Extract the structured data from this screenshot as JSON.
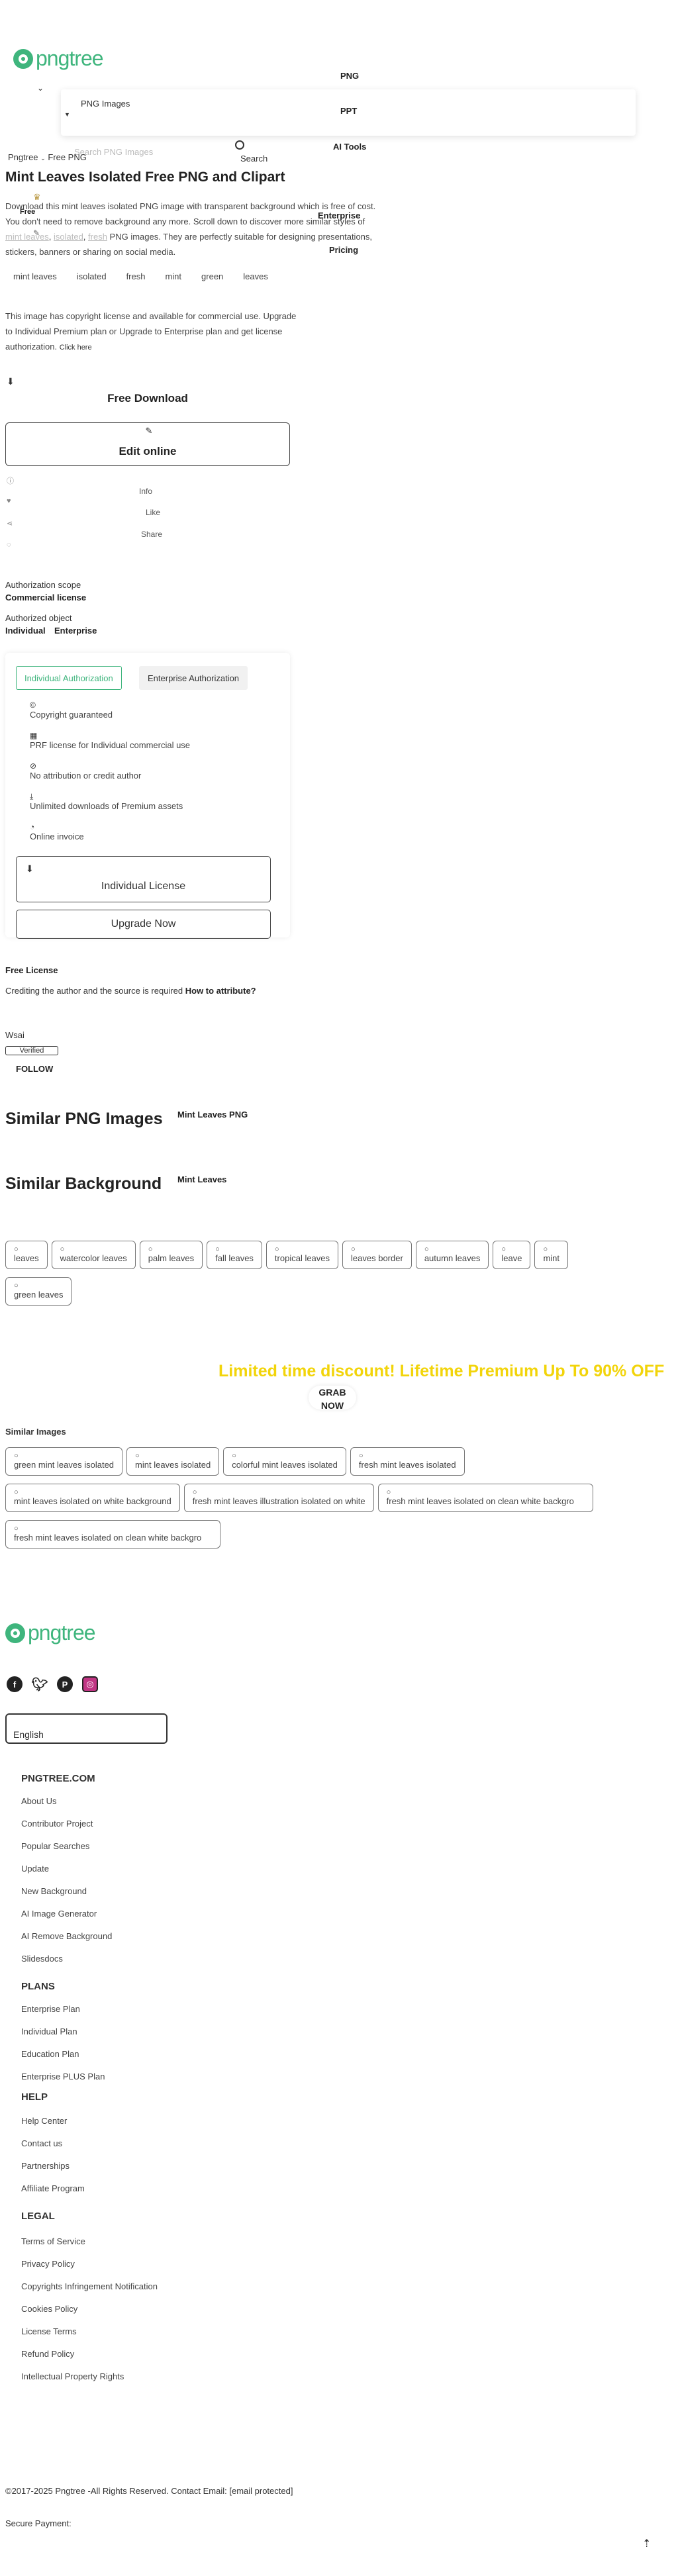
{
  "header": {
    "logo_text": "pngtree",
    "nav": {
      "png": "PNG",
      "ppt": "PPT",
      "ai_tools": "AI Tools",
      "enterprise": "Enterprise",
      "pricing": "Pricing",
      "free": "Free"
    },
    "search": {
      "category": "PNG Images",
      "placeholder": "Search PNG Images",
      "button": "Search"
    }
  },
  "breadcrumb": {
    "home": "Pngtree",
    "current": "Free PNG"
  },
  "main": {
    "title": "Mint Leaves Isolated Free PNG and Clipart",
    "desc_before": "Download this mint leaves isolated PNG image with transparent background which is free of cost. You don't need to remove background any more. Scroll down to discover more similar styles of ",
    "desc_kw1": "mint leaves",
    "desc_kw2": "isolated",
    "desc_kw3": "fresh",
    "desc_after": " PNG images. They are perfectly suitable for designing presentations, stickers, banners or sharing on social media.",
    "tags": [
      "mint leaves",
      "isolated",
      "fresh",
      "mint",
      "green",
      "leaves"
    ],
    "copyright_text": "This image has copyright license and available for commercial use. Upgrade to Individual Premium plan  or  Upgrade to Enterprise plan and get license authorization.",
    "click_here": "Click here",
    "free_download": "Free Download",
    "edit_online": "Edit online",
    "actions": {
      "info": "Info",
      "like": "Like",
      "share": "Share"
    }
  },
  "authorization": {
    "scope_label": "Authorization scope",
    "scope_value": "Commercial license",
    "object_label": "Authorized object",
    "object_values": [
      "Individual",
      "Enterprise"
    ],
    "tabs": [
      "Individual Authorization",
      "Enterprise Authorization"
    ],
    "features": [
      "Copyright guaranteed",
      "PRF license for Individual commercial use",
      "No attribution or credit author",
      "Unlimited downloads of Premium assets",
      "Online invoice"
    ],
    "license_button": "Individual License",
    "upgrade_button": "Upgrade Now"
  },
  "free_license": {
    "title": "Free License",
    "text": "Crediting the author and the source is required",
    "link": "How to attribute?"
  },
  "author": {
    "name": "Wsai",
    "badge": "Verified",
    "follow": "FOLLOW"
  },
  "similar_png": {
    "title": "Similar PNG Images",
    "subtitle": "Mint Leaves PNG"
  },
  "similar_bg": {
    "title": "Similar Background",
    "subtitle": "Mint Leaves"
  },
  "tag_chips": [
    "leaves",
    "watercolor leaves",
    "palm leaves",
    "fall leaves",
    "tropical leaves",
    "leaves border",
    "autumn leaves",
    "leave",
    "mint",
    "green leaves"
  ],
  "promo": {
    "text": "Limited time discount! Lifetime Premium Up To 90% OFF",
    "button": "GRAB NOW"
  },
  "similar_images": {
    "title": "Similar Images",
    "items": [
      "green mint leaves isolated",
      "mint leaves isolated",
      "colorful mint leaves isolated",
      "fresh mint leaves isolated",
      "mint leaves isolated on white background",
      "fresh mint leaves illustration isolated on white",
      "fresh mint leaves isolated on clean white backgro",
      "fresh mint leaves isolated on clean white backgro"
    ]
  },
  "footer": {
    "language": "English",
    "sections": [
      {
        "title": "PNGTREE.COM",
        "links": [
          "About Us",
          "Contributor Project",
          "Popular Searches",
          "Update",
          "New Background",
          "AI Image Generator",
          "AI Remove Background",
          "Slidesdocs"
        ]
      },
      {
        "title": "PLANS",
        "links": [
          "Enterprise Plan",
          "Individual Plan",
          "Education Plan",
          "Enterprise PLUS Plan"
        ]
      },
      {
        "title": "HELP",
        "links": [
          "Help Center",
          "Contact us",
          "Partnerships",
          "Affiliate Program"
        ]
      },
      {
        "title": "LEGAL",
        "links": [
          "Terms of Service",
          "Privacy Policy",
          "Copyrights Infringement Notification",
          "Cookies Policy",
          "License Terms",
          "Refund Policy",
          "Intellectual Property Rights"
        ]
      }
    ],
    "copyright": "©2017-2025 Pngtree -All Rights Reserved.  Contact Email: [email protected]",
    "secure_payment": "Secure Payment:"
  },
  "colors": {
    "brand": "#3fb57d",
    "promo": "#f2d40a"
  }
}
